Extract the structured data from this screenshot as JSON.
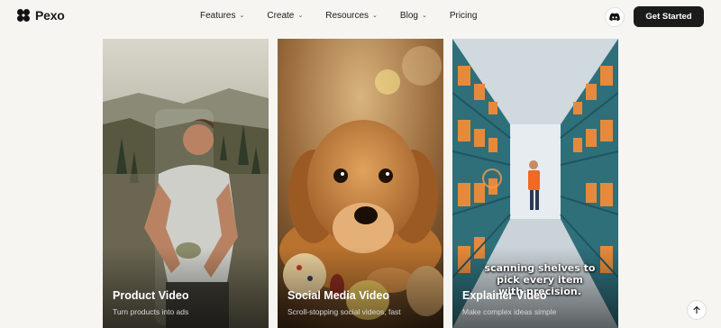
{
  "brand": {
    "name": "Pexo"
  },
  "nav": [
    {
      "label": "Features",
      "has_dropdown": true
    },
    {
      "label": "Create",
      "has_dropdown": true
    },
    {
      "label": "Resources",
      "has_dropdown": true
    },
    {
      "label": "Blog",
      "has_dropdown": true
    },
    {
      "label": "Pricing",
      "has_dropdown": false
    }
  ],
  "header_actions": {
    "discord_icon": "discord-icon",
    "cta_label": "Get Started"
  },
  "cards": [
    {
      "title": "Product Video",
      "subtitle": "Turn products into ads"
    },
    {
      "title": "Social Media Video",
      "subtitle": "Scroll-stopping social videos, fast"
    },
    {
      "title": "Explainer Video",
      "subtitle": "Make complex ideas simple",
      "caption": "scanning shelves to pick every item with precision."
    }
  ],
  "icons": {
    "scroll_top": "arrow-up-icon"
  },
  "colors": {
    "background": "#f6f5f1",
    "cta_bg": "#1b1b1b",
    "cta_text": "#ffffff"
  }
}
